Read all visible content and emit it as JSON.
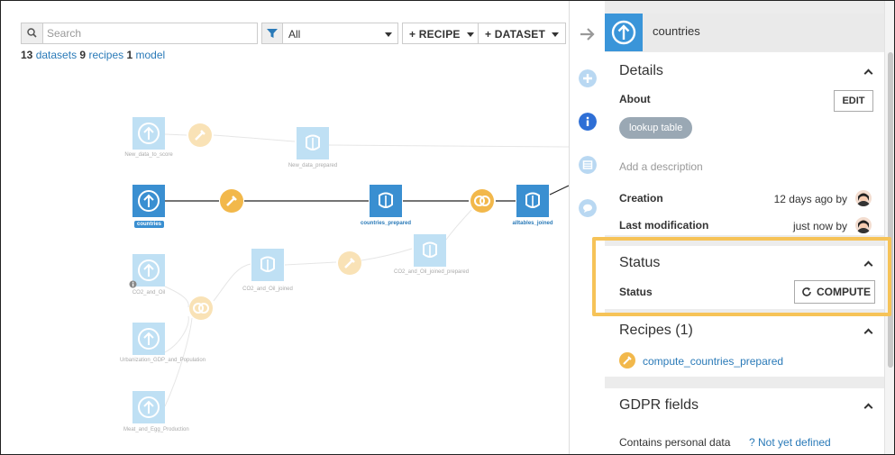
{
  "toolbar": {
    "search_placeholder": "Search",
    "filter_value": "All",
    "recipe_button": "+ RECIPE",
    "dataset_button": "+ DATASET"
  },
  "counts": {
    "datasets_num": "13",
    "datasets_label": "datasets",
    "recipes_num": "9",
    "recipes_label": "recipes",
    "models_num": "1",
    "models_label": "model"
  },
  "flow": {
    "nodes": {
      "new_data_to_score": "New_data_to_score",
      "new_data_prepared": "New_data_prepared",
      "countries": "countries",
      "countries_prepared": "countries_prepared",
      "alltables_joined": "alltables_joined",
      "co2_and_oil": "CO2_and_Oil",
      "co2_and_oil_joined": "CO2_and_Oil_joined",
      "co2_and_oil_joined_prepared": "CO2_and_Oil_joined_prepared",
      "urbanization": "Urbanization_GDP_and_Population",
      "meat_and_egg": "Meat_and_Egg_Production"
    }
  },
  "panel": {
    "title": "countries",
    "details": {
      "title": "Details",
      "about_label": "About",
      "edit_button": "EDIT",
      "tag": "lookup table",
      "description_placeholder": "Add a description",
      "creation_label": "Creation",
      "creation_value": "12 days ago by",
      "last_mod_label": "Last modification",
      "last_mod_value": "just now by"
    },
    "status": {
      "title": "Status",
      "label": "Status",
      "compute_button": "COMPUTE"
    },
    "recipes": {
      "title": "Recipes (1)",
      "item": "compute_countries_prepared"
    },
    "gdpr": {
      "title": "GDPR fields",
      "personal_label": "Contains personal data",
      "personal_value": "? Not yet defined"
    }
  },
  "colors": {
    "accent": "#3a95d9",
    "link": "#2a7ab8",
    "recipe_orange": "#f2b84b",
    "highlight": "#f6c358"
  }
}
